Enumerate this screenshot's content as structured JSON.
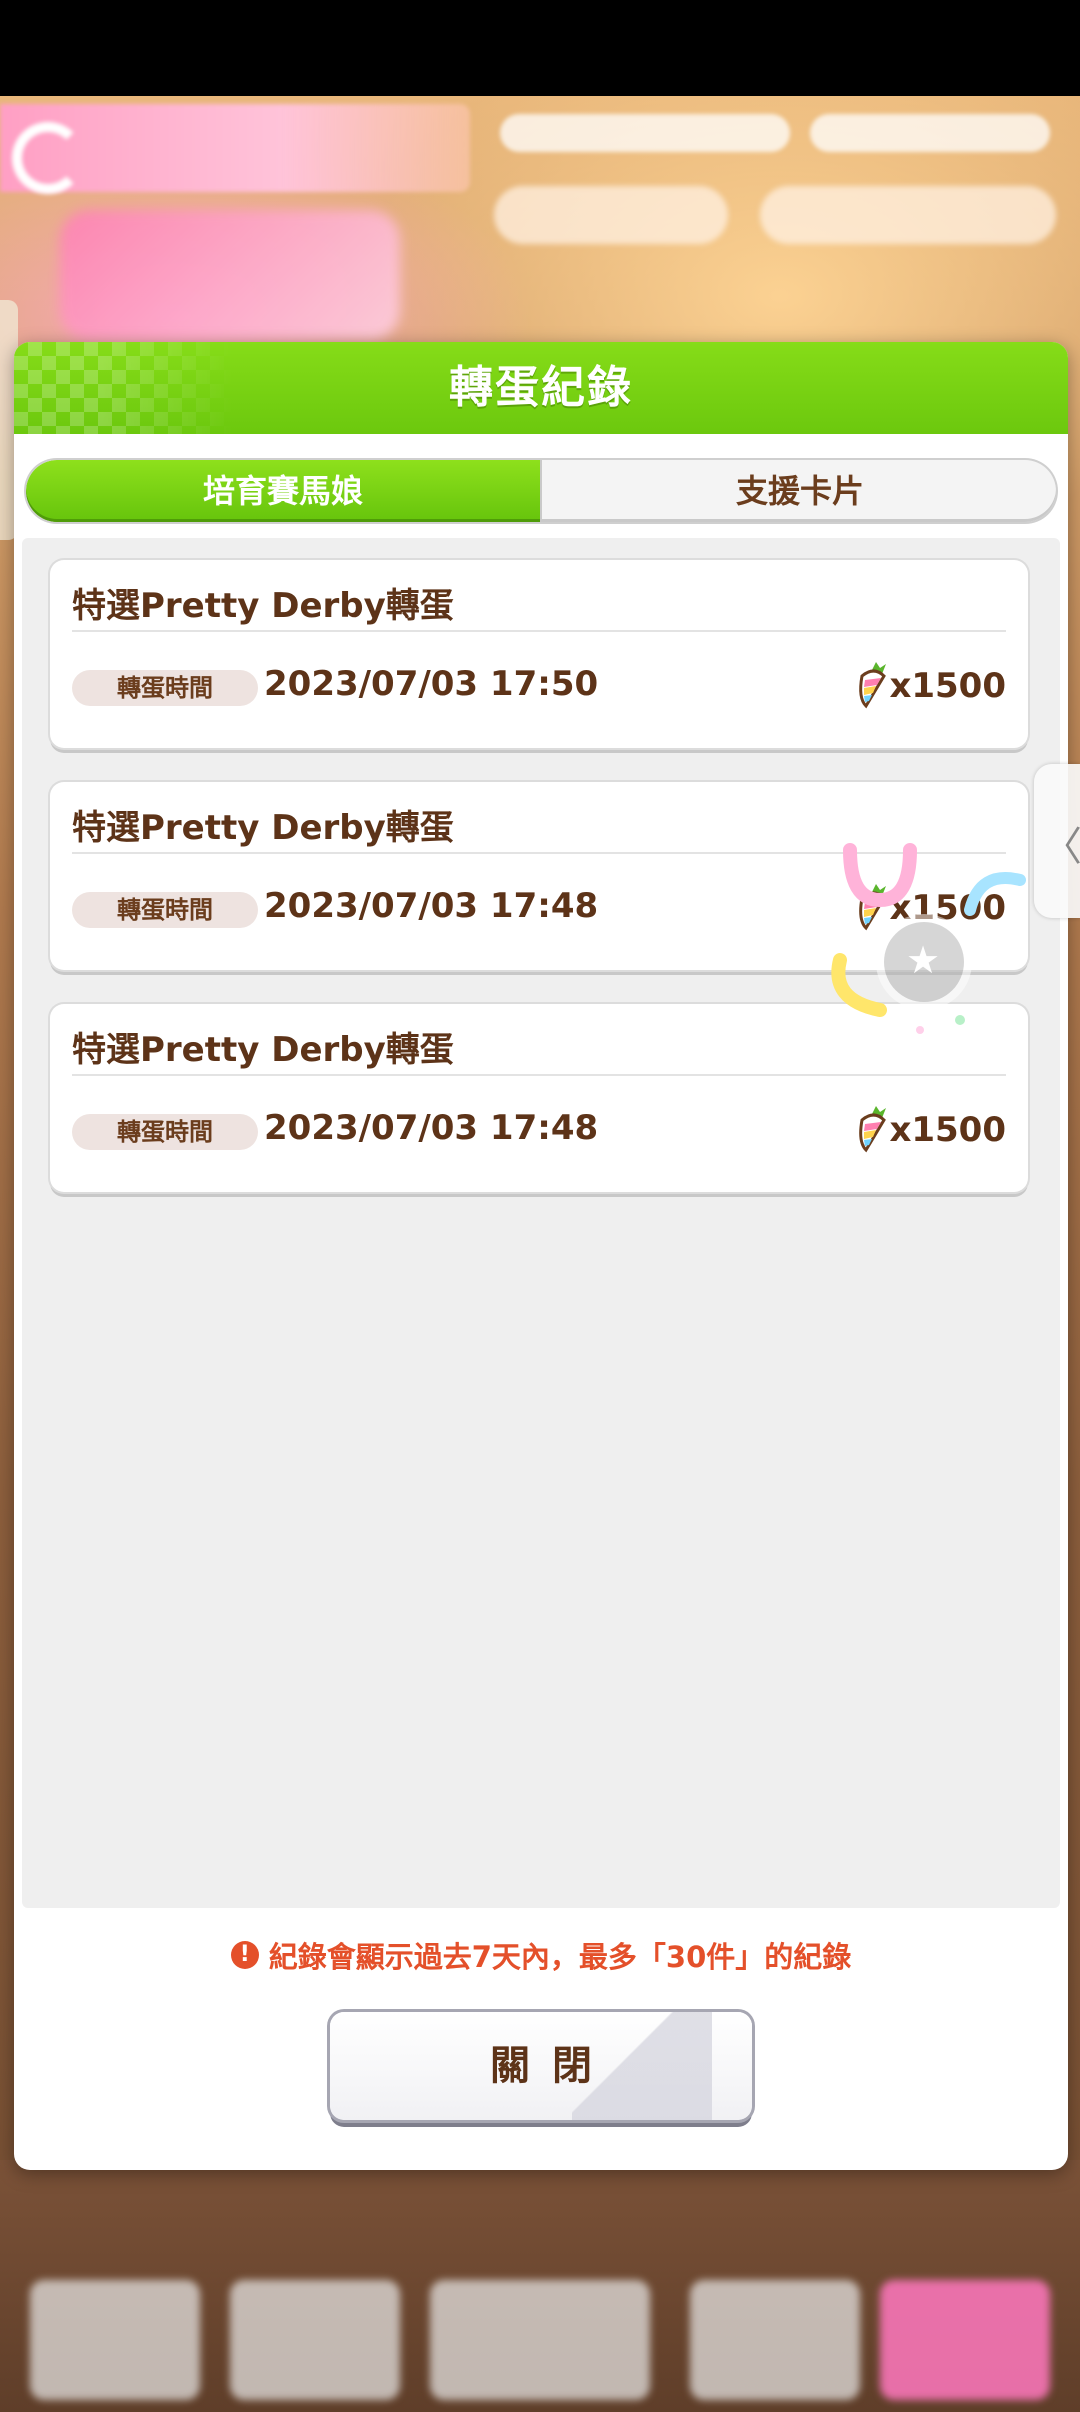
{
  "modal": {
    "title": "轉蛋紀錄",
    "tabs": [
      {
        "label": "培育賽馬娘",
        "active": true
      },
      {
        "label": "支援卡片",
        "active": false
      }
    ],
    "time_label": "轉蛋時間",
    "records": [
      {
        "title": "特選Pretty Derby轉蛋",
        "time": "2023/07/03 17:50",
        "amount": "x1500",
        "currency_icon": "rainbow-carrot-icon"
      },
      {
        "title": "特選Pretty Derby轉蛋",
        "time": "2023/07/03 17:48",
        "amount": "x1500",
        "currency_icon": "rainbow-carrot-icon"
      },
      {
        "title": "特選Pretty Derby轉蛋",
        "time": "2023/07/03 17:48",
        "amount": "x1500",
        "currency_icon": "rainbow-carrot-icon"
      }
    ],
    "notice": "紀錄會顯示過去7天內，最多「30件」的紀錄",
    "notice_icon": "!",
    "close_label": "關閉"
  },
  "side_handle_glyph": "〈",
  "float_button_glyph": "★",
  "colors": {
    "header_green": "#6cc80e",
    "text_brown": "#5d3318",
    "notice_red": "#e4502a",
    "background_blur": "#b07a4e"
  }
}
